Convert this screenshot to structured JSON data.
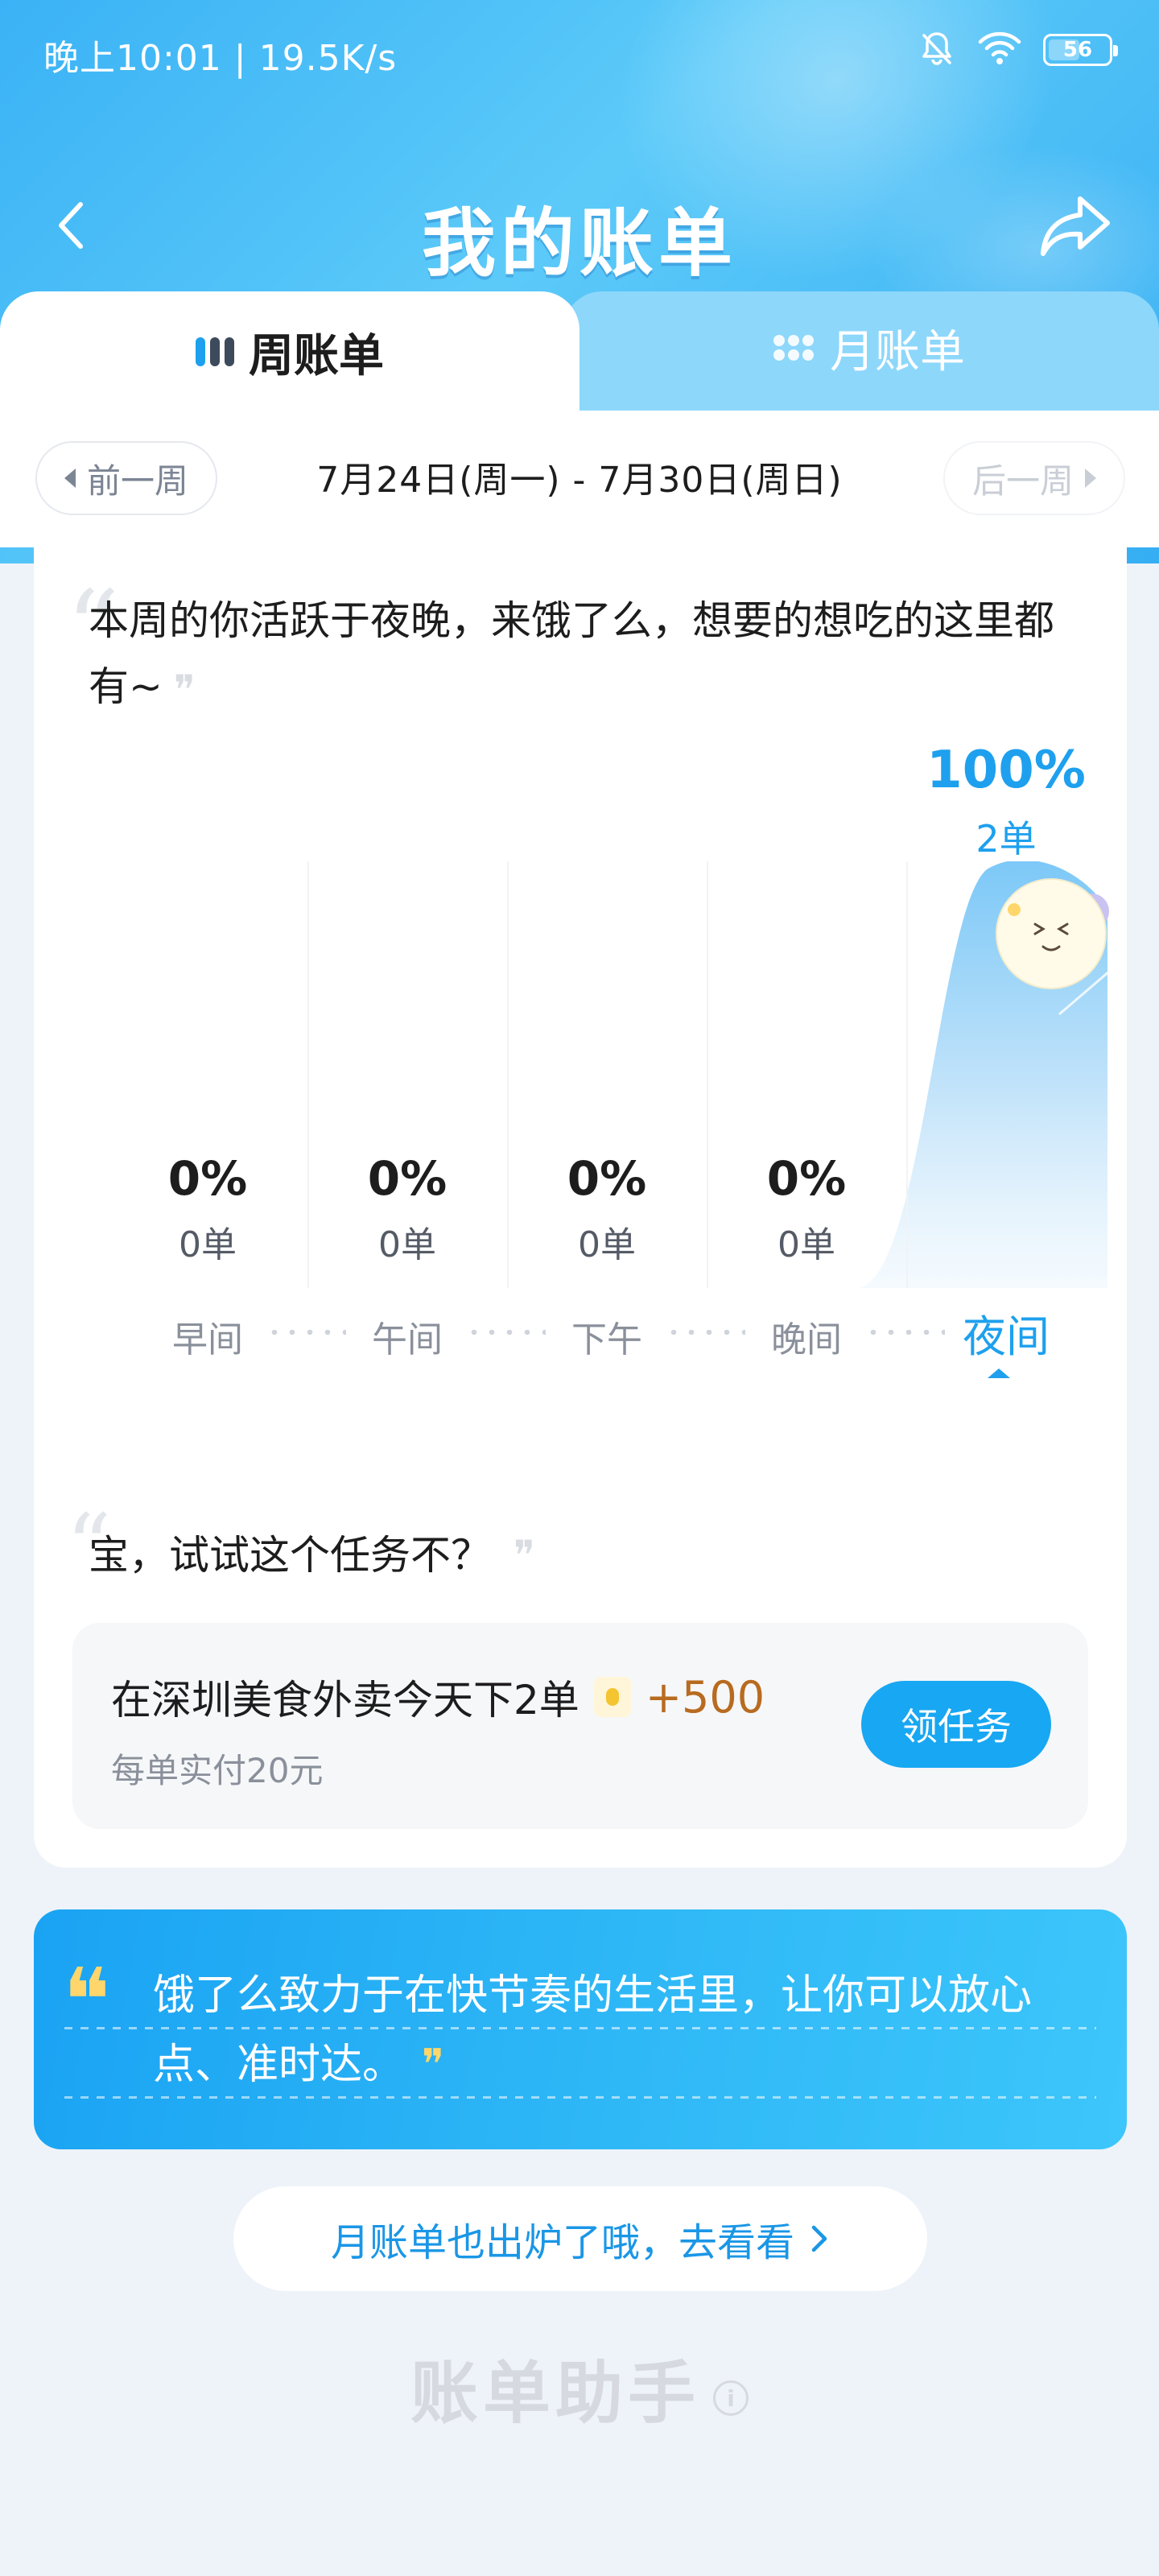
{
  "status_bar": {
    "time_speed": "晚上10:01 | 19.5K/s",
    "battery": "56",
    "icons": [
      "bell-muted-icon",
      "wifi-icon",
      "battery-icon"
    ]
  },
  "header": {
    "title": "我的账单",
    "back_icon": "chevron-left-icon",
    "share_icon": "share-arrow-icon"
  },
  "tabs": {
    "weekly": "周账单",
    "monthly": "月账单",
    "active": "weekly"
  },
  "week_nav": {
    "prev": "前一周",
    "next": "后一周",
    "range": "7月24日(周一)  -  7月30日(周日)"
  },
  "intro": {
    "text": "本周的你活跃于夜晚，来饿了么，想要的想吃的这里都有~"
  },
  "chart_data": {
    "type": "bar",
    "categories": [
      "早间",
      "午间",
      "下午",
      "晚间",
      "夜间"
    ],
    "percent_labels": [
      "0%",
      "0%",
      "0%",
      "0%",
      "100%"
    ],
    "count_labels": [
      "0单",
      "0单",
      "0单",
      "0单",
      "2单"
    ],
    "values": [
      0,
      0,
      0,
      0,
      2
    ],
    "percent": [
      0,
      0,
      0,
      0,
      100
    ],
    "highlight_index": 4,
    "highlight_color": "#1ea0ee"
  },
  "task": {
    "prompt": "宝，试试这个任务不？",
    "title": "在深圳美食外卖今天下2单",
    "reward": "+500",
    "subtitle": "每单实付20元",
    "button": "领任务"
  },
  "slogan": {
    "line1": "饿了么致力于在快节奏的生活里，让你可以放心",
    "line2": "点、准时达。"
  },
  "month_link": {
    "label": "月账单也出炉了哦，去看看",
    "icon": "chevron-right-icon"
  },
  "footer": {
    "brand": "账单助手",
    "info_icon": "info-icon"
  },
  "colors": {
    "brand_blue": "#1ea0ee",
    "reward_orange": "#b86b1f",
    "slogan_quote": "#ffd66b"
  }
}
